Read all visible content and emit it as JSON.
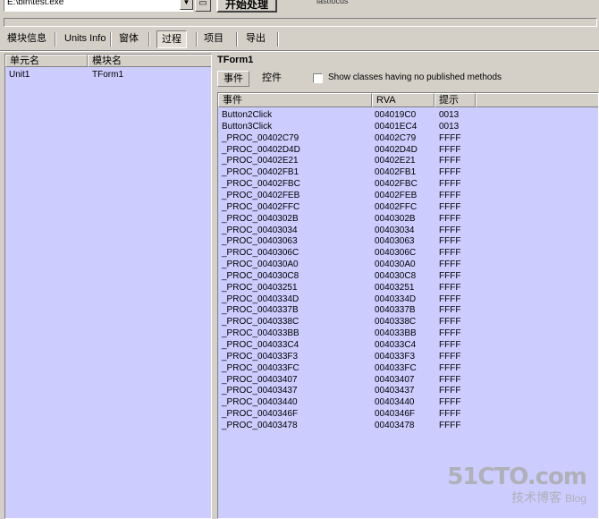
{
  "toolbar": {
    "path": "E:\\bin\\test.exe",
    "process_label": "开始处理",
    "status_text": "lastfocus"
  },
  "tabs": [
    "模块信息",
    "Units Info",
    "窗体",
    "过程",
    "项目",
    "导出"
  ],
  "active_tab": "过程",
  "units": {
    "headers": [
      "单元名",
      "模块名"
    ],
    "rows": [
      {
        "unit": "Unit1",
        "module": "TForm1"
      }
    ]
  },
  "form_title": "TForm1",
  "subtabs": [
    "事件",
    "控件"
  ],
  "checkbox": {
    "label": "Show classes having no published methods",
    "checked": false
  },
  "procs": {
    "headers": [
      "事件",
      "RVA",
      "提示"
    ],
    "rows": [
      {
        "name": "Button2Click",
        "rva": "004019C0",
        "hint": "0013"
      },
      {
        "name": "Button3Click",
        "rva": "00401EC4",
        "hint": "0013"
      },
      {
        "name": "_PROC_00402C79",
        "rva": "00402C79",
        "hint": "FFFF"
      },
      {
        "name": "_PROC_00402D4D",
        "rva": "00402D4D",
        "hint": "FFFF"
      },
      {
        "name": "_PROC_00402E21",
        "rva": "00402E21",
        "hint": "FFFF"
      },
      {
        "name": "_PROC_00402FB1",
        "rva": "00402FB1",
        "hint": "FFFF"
      },
      {
        "name": "_PROC_00402FBC",
        "rva": "00402FBC",
        "hint": "FFFF"
      },
      {
        "name": "_PROC_00402FEB",
        "rva": "00402FEB",
        "hint": "FFFF"
      },
      {
        "name": "_PROC_00402FFC",
        "rva": "00402FFC",
        "hint": "FFFF"
      },
      {
        "name": "_PROC_0040302B",
        "rva": "0040302B",
        "hint": "FFFF"
      },
      {
        "name": "_PROC_00403034",
        "rva": "00403034",
        "hint": "FFFF"
      },
      {
        "name": "_PROC_00403063",
        "rva": "00403063",
        "hint": "FFFF"
      },
      {
        "name": "_PROC_0040306C",
        "rva": "0040306C",
        "hint": "FFFF"
      },
      {
        "name": "_PROC_004030A0",
        "rva": "004030A0",
        "hint": "FFFF"
      },
      {
        "name": "_PROC_004030C8",
        "rva": "004030C8",
        "hint": "FFFF"
      },
      {
        "name": "_PROC_00403251",
        "rva": "00403251",
        "hint": "FFFF"
      },
      {
        "name": "_PROC_0040334D",
        "rva": "0040334D",
        "hint": "FFFF"
      },
      {
        "name": "_PROC_0040337B",
        "rva": "0040337B",
        "hint": "FFFF"
      },
      {
        "name": "_PROC_0040338C",
        "rva": "0040338C",
        "hint": "FFFF"
      },
      {
        "name": "_PROC_004033BB",
        "rva": "004033BB",
        "hint": "FFFF"
      },
      {
        "name": "_PROC_004033C4",
        "rva": "004033C4",
        "hint": "FFFF"
      },
      {
        "name": "_PROC_004033F3",
        "rva": "004033F3",
        "hint": "FFFF"
      },
      {
        "name": "_PROC_004033FC",
        "rva": "004033FC",
        "hint": "FFFF"
      },
      {
        "name": "_PROC_00403407",
        "rva": "00403407",
        "hint": "FFFF"
      },
      {
        "name": "_PROC_00403437",
        "rva": "00403437",
        "hint": "FFFF"
      },
      {
        "name": "_PROC_00403440",
        "rva": "00403440",
        "hint": "FFFF"
      },
      {
        "name": "_PROC_0040346F",
        "rva": "0040346F",
        "hint": "FFFF"
      },
      {
        "name": "_PROC_00403478",
        "rva": "00403478",
        "hint": "FFFF"
      }
    ]
  },
  "watermark": {
    "site": "51CTO.com",
    "sub": "技术博客",
    "blog": "Blog"
  },
  "colors": {
    "window_bg": "#d4d0c8",
    "list_bg": "#ccccff"
  }
}
